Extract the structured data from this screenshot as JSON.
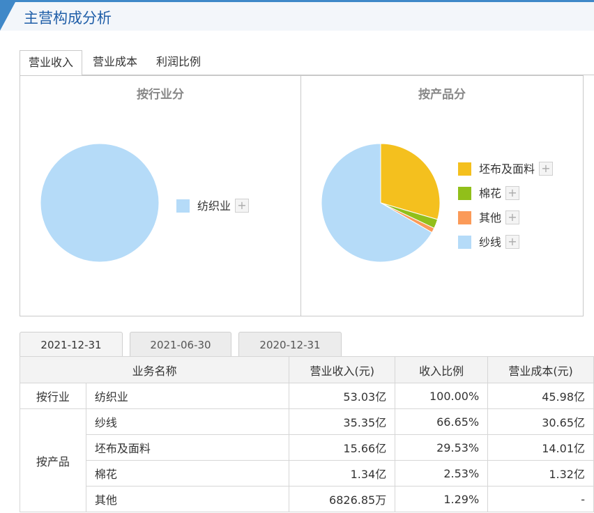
{
  "header": {
    "title": "主营构成分析"
  },
  "tabs": [
    {
      "label": "营业收入"
    },
    {
      "label": "营业成本"
    },
    {
      "label": "利润比例"
    }
  ],
  "chart_data": [
    {
      "type": "pie",
      "title": "按行业分",
      "categories": [
        "纺织业"
      ],
      "values": [
        100.0
      ],
      "colors": [
        "#b5dbf8"
      ],
      "legend": "right"
    },
    {
      "type": "pie",
      "title": "按产品分",
      "categories": [
        "坯布及面料",
        "棉花",
        "其他",
        "纱线"
      ],
      "values": [
        29.53,
        2.53,
        1.29,
        66.65
      ],
      "colors": [
        "#f4c01e",
        "#91bf1a",
        "#fb9a58",
        "#b5dbf8"
      ],
      "legend": "right"
    }
  ],
  "legend_plus": "+",
  "date_tabs": [
    {
      "label": "2021-12-31"
    },
    {
      "label": "2021-06-30"
    },
    {
      "label": "2020-12-31"
    }
  ],
  "table": {
    "headers": [
      "业务名称",
      "营业收入(元)",
      "收入比例",
      "营业成本(元)"
    ],
    "groups": [
      {
        "label": "按行业",
        "rows": [
          {
            "name": "纺织业",
            "revenue": "53.03亿",
            "ratio": "100.00%",
            "cost": "45.98亿"
          }
        ]
      },
      {
        "label": "按产品",
        "rows": [
          {
            "name": "纱线",
            "revenue": "35.35亿",
            "ratio": "66.65%",
            "cost": "30.65亿"
          },
          {
            "name": "坯布及面料",
            "revenue": "15.66亿",
            "ratio": "29.53%",
            "cost": "14.01亿"
          },
          {
            "name": "棉花",
            "revenue": "1.34亿",
            "ratio": "2.53%",
            "cost": "1.32亿"
          },
          {
            "name": "其他",
            "revenue": "6826.85万",
            "ratio": "1.29%",
            "cost": "-"
          }
        ]
      }
    ]
  }
}
